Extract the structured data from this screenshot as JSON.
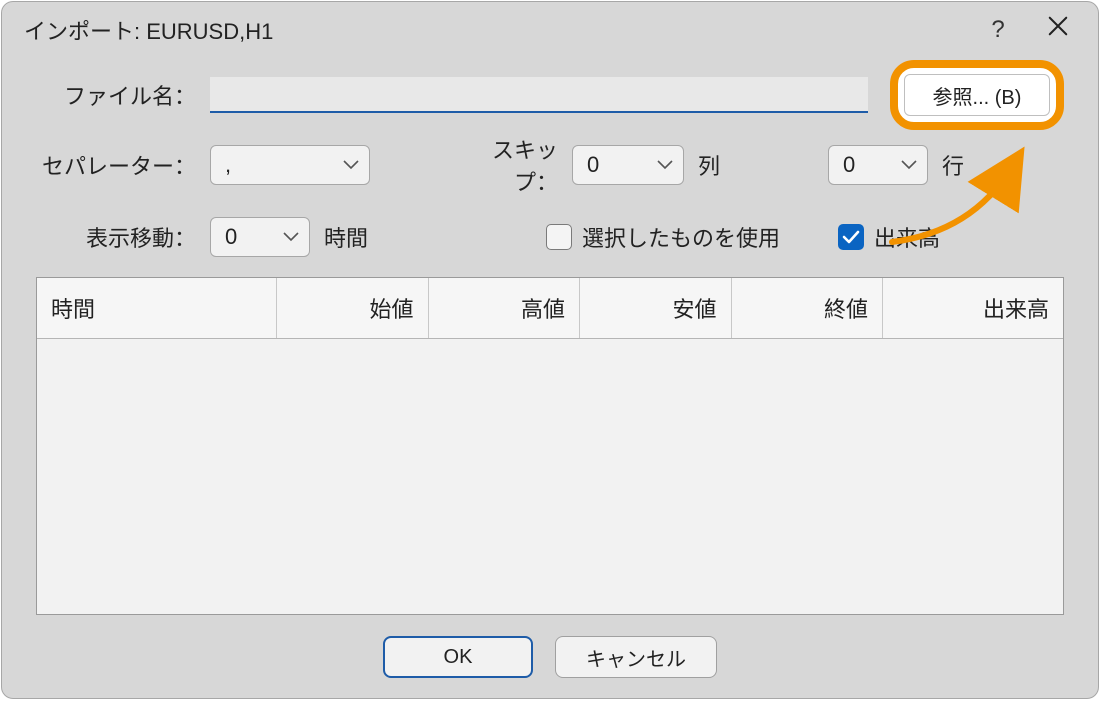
{
  "title": "インポート: EURUSD,H1",
  "labels": {
    "filename": "ファイル名：",
    "separator": "セパレーター：",
    "skip": "スキップ：",
    "col_unit": "列",
    "row_unit": "行",
    "shift": "表示移動：",
    "shift_unit": "時間",
    "use_selected": "選択したものを使用",
    "volume_chk": "出来高"
  },
  "values": {
    "filename": "",
    "separator": ",",
    "skip_cols": "0",
    "skip_rows": "0",
    "shift": "0",
    "use_selected_checked": false,
    "volume_checked": true
  },
  "buttons": {
    "browse": "参照... (B)",
    "ok": "OK",
    "cancel": "キャンセル"
  },
  "table": {
    "columns": [
      "時間",
      "始値",
      "高値",
      "安値",
      "終値",
      "出来高"
    ]
  }
}
